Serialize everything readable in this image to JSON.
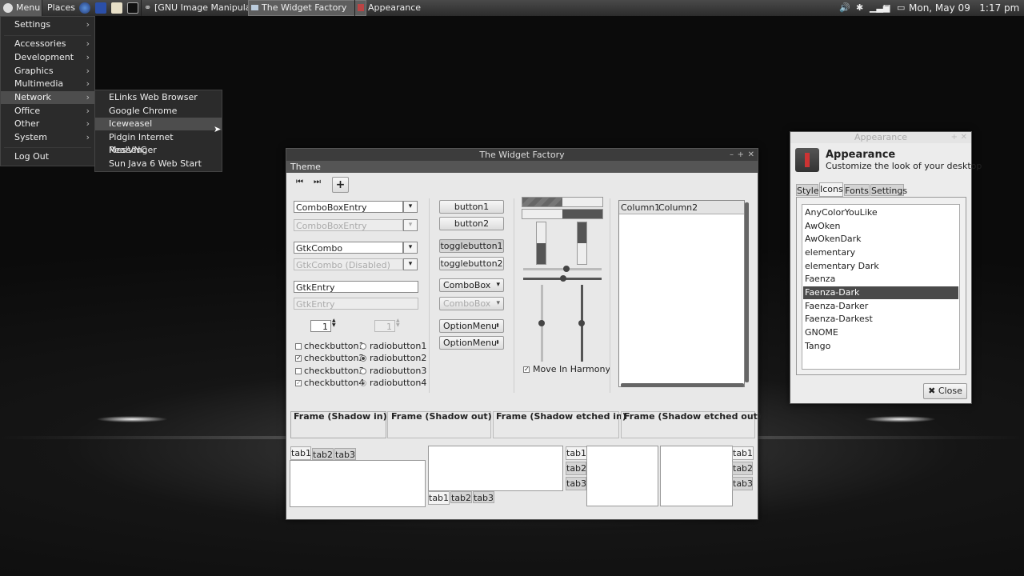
{
  "panel": {
    "menu_label": "Menu",
    "places_label": "Places",
    "tasks": [
      "[GNU Image Manipula...",
      "The Widget Factory",
      "Appearance"
    ],
    "clock": "Mon, May 09   1:17 pm"
  },
  "main_menu": {
    "items": [
      "Settings",
      "Accessories",
      "Development",
      "Graphics",
      "Multimedia",
      "Network",
      "Office",
      "Other",
      "System",
      "Log Out"
    ],
    "selected": "Network"
  },
  "network_menu": {
    "items": [
      "ELinks Web Browser",
      "Google Chrome",
      "Iceweasel",
      "Pidgin Internet Messenger",
      "RealVNC",
      "Sun Java 6 Web Start"
    ],
    "selected": "Iceweasel"
  },
  "widget_factory": {
    "title": "The Widget Factory",
    "menubar": "Theme",
    "combo_entry": "ComboBoxEntry",
    "combo_entry_disabled": "ComboBoxEntry",
    "gtkcombo": "GtkCombo",
    "gtkcombo_disabled": "GtkCombo (Disabled)",
    "gtkentry": "GtkEntry",
    "gtkentry_disabled": "GtkEntry",
    "spin1": "1",
    "spin2": "1",
    "checks": [
      "checkbutton1",
      "checkbutton2",
      "checkbutton3",
      "checkbutton4"
    ],
    "radios": [
      "radiobutton1",
      "radiobutton2",
      "radiobutton3",
      "radiobutton4"
    ],
    "button1": "button1",
    "button2": "button2",
    "toggle1": "togglebutton1",
    "toggle2": "togglebutton2",
    "combobox": "ComboBox",
    "combobox_disabled": "ComboBox",
    "optionmenu1": "OptionMenu",
    "optionmenu2": "OptionMenu",
    "harmony": "Move In Harmony",
    "column1": "Column1",
    "column2": "Column2",
    "frames": [
      "Frame (Shadow in)",
      "Frame (Shadow out)",
      "Frame (Shadow etched in)",
      "Frame (Shadow etched out)"
    ],
    "tabs": [
      "tab1",
      "tab2",
      "tab3"
    ]
  },
  "appearance": {
    "window_title": "Appearance",
    "title": "Appearance",
    "subtitle": "Customize the look of your desktop",
    "tabs": [
      "Style",
      "Icons",
      "Fonts",
      "Settings"
    ],
    "active_tab": "Icons",
    "themes": [
      "AnyColorYouLike",
      "AwOken",
      "AwOkenDark",
      "elementary",
      "elementary Dark",
      "Faenza",
      "Faenza-Dark",
      "Faenza-Darker",
      "Faenza-Darkest",
      "GNOME",
      "Tango"
    ],
    "selected_theme": "Faenza-Dark",
    "close_label": "Close"
  }
}
